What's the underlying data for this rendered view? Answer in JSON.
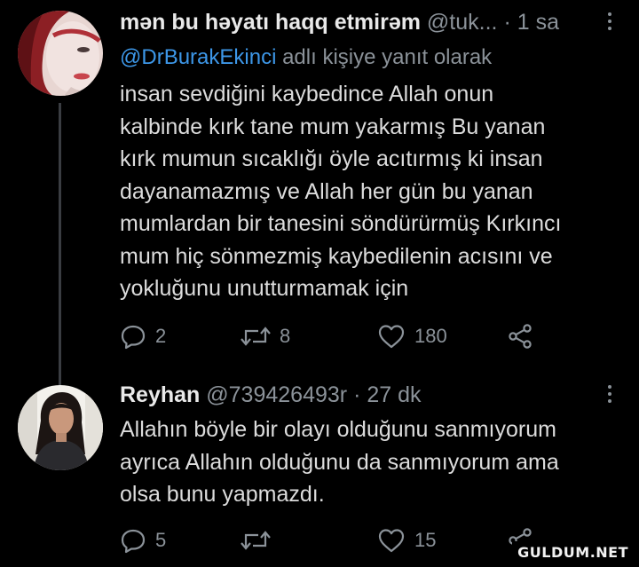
{
  "tweets": [
    {
      "name": "mən bu həyatı haqq etmirəm",
      "handle": "@tuk...",
      "separator": "·",
      "time": "1 sa",
      "reply_prefix": "",
      "reply_mention": "@DrBurakEkinci",
      "reply_suffix": " adlı kişiye yanıt olarak",
      "text": "insan sevdiğini kaybedince Allah onun\nkalbinde kırk tane mum yakarmış Bu yanan\nkırk mumun sıcaklığı öyle acıtırmış ki insan\ndayanamazmış ve Allah her gün bu yanan\nmumlardan bir tanesini söndürürmüş Kırkıncı\nmum hiç sönmezmiş kaybedilenin acısını ve\nyokluğunu unutturmamak için",
      "replies": "2",
      "retweets": "8",
      "likes": "180"
    },
    {
      "name": "Reyhan",
      "handle": "@739426493r",
      "separator": "·",
      "time": "27 dk",
      "text": "Allahın böyle bir olayı olduğunu sanmıyorum\nayrıca Allahın olduğunu da sanmıyorum ama\nolsa bunu yapmazdı.",
      "replies": "5",
      "retweets": "",
      "likes": "15"
    }
  ],
  "icons": {
    "reply": "reply-icon",
    "retweet": "retweet-icon",
    "like": "heart-icon",
    "share": "share-icon",
    "more": "more-icon"
  },
  "colors": {
    "background": "#000000",
    "text": "#dcdcdc",
    "secondary": "#8b9299",
    "mention": "#3d97e8"
  },
  "watermark": "GULDUM.NET"
}
